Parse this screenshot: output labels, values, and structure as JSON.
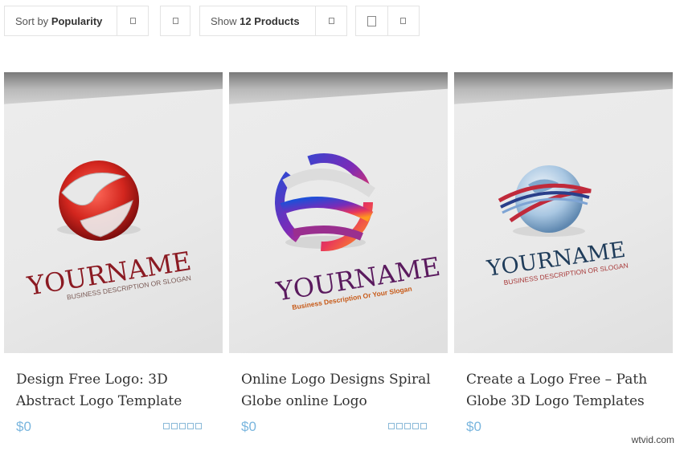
{
  "toolbar": {
    "sort_prefix": "Sort by",
    "sort_value": "Popularity",
    "show_prefix": "Show",
    "show_value": "12 Products"
  },
  "products": [
    {
      "title": "Design Free Logo: 3D Abstract Logo Template",
      "price": "$0",
      "logo_text": "YOURNAME",
      "logo_tagline": "BUSINESS DESCRIPTION OR SLOGAN",
      "accent": "#8b1a22"
    },
    {
      "title": "Online Logo Designs Spiral Globe online Logo",
      "price": "$0",
      "logo_text": "YOURNAME",
      "logo_tagline": "Business Description Or Your Slogan",
      "accent": "#5a1a5e"
    },
    {
      "title": "Create a Logo Free – Path Globe 3D Logo Templates",
      "price": "$0",
      "logo_text": "YOURNAME",
      "logo_tagline": "BUSINESS DESCRIPTION OR SLOGAN",
      "accent": "#1f3c5a"
    }
  ],
  "watermark": "wtvid.com"
}
